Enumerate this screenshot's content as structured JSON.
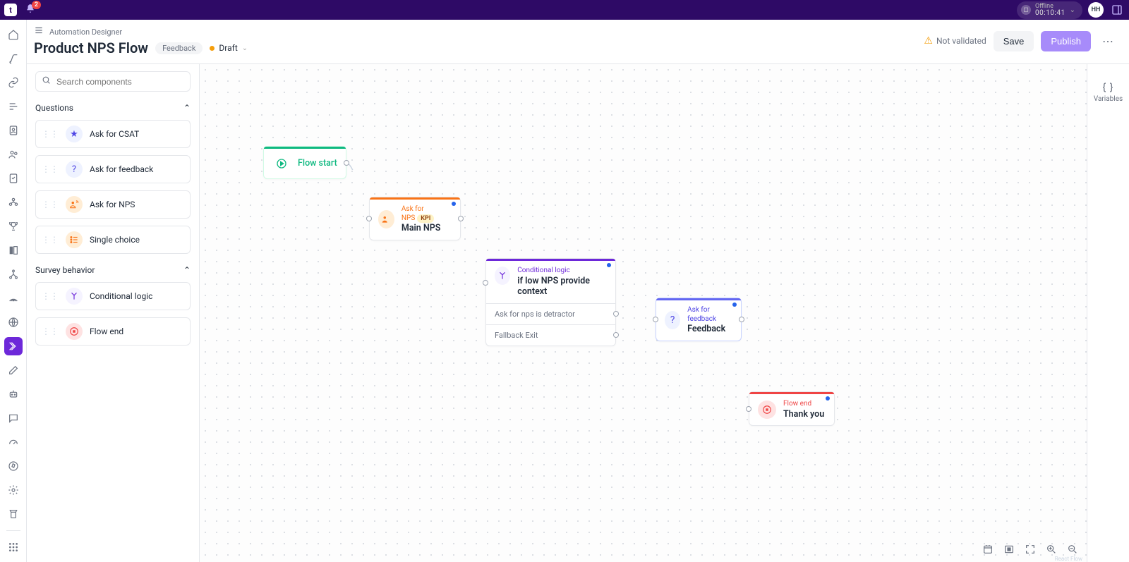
{
  "topbar": {
    "logo_letter": "t",
    "notification_count": "2",
    "status_label": "Offline",
    "status_time": "00:10:41",
    "avatar_initials": "HH"
  },
  "header": {
    "breadcrumb": "Automation Designer",
    "title": "Product NPS Flow",
    "tag": "Feedback",
    "status": "Draft",
    "validation": "Not validated",
    "save": "Save",
    "publish": "Publish"
  },
  "panel": {
    "search_placeholder": "Search components",
    "section1": "Questions",
    "section2": "Survey behavior",
    "components": {
      "csat": "Ask for CSAT",
      "feedback": "Ask for feedback",
      "nps": "Ask for NPS",
      "single": "Single choice",
      "cond": "Conditional logic",
      "end": "Flow end"
    }
  },
  "nodes": {
    "start": {
      "name": "Flow start"
    },
    "nps": {
      "type": "Ask for NPS",
      "kpi": "KPI",
      "name": "Main NPS"
    },
    "cond": {
      "type": "Conditional logic",
      "name": "if low NPS provide context",
      "exit1": "Ask for nps is detractor",
      "exit2": "Fallback Exit"
    },
    "fb": {
      "type": "Ask for feedback",
      "name": "Feedback"
    },
    "end": {
      "type": "Flow end",
      "name": "Thank you"
    }
  },
  "rightrail": {
    "variables": "Variables"
  },
  "canvas": {
    "attribution": "React Flow"
  }
}
